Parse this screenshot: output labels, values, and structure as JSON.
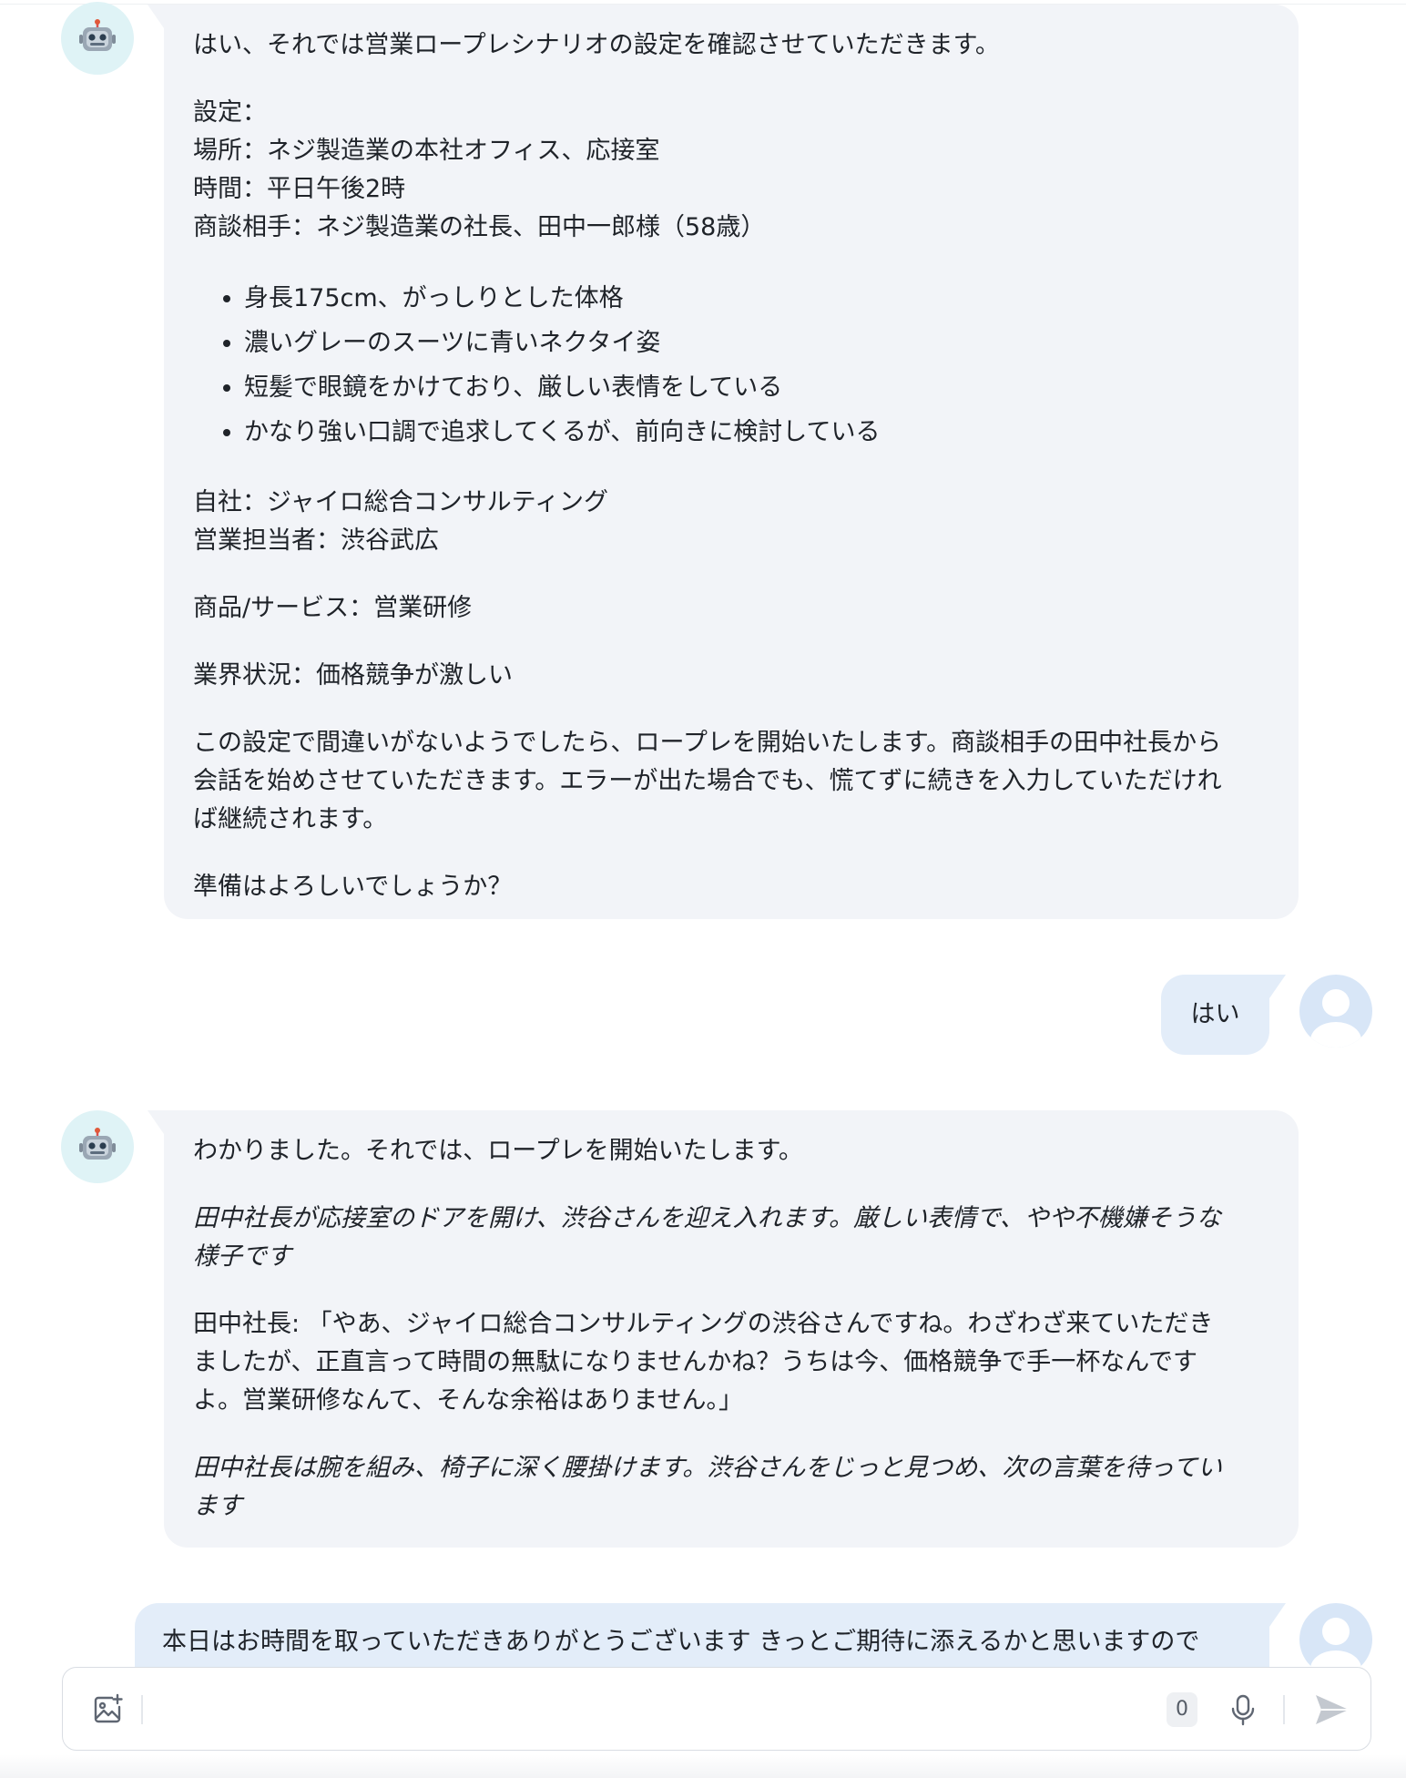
{
  "colors": {
    "bot_bubble": "#f2f4f8",
    "user_bubble": "#e3edf9",
    "bot_avatar_bg": "#dff3f6",
    "user_avatar_bg": "#d8e6f7",
    "text": "#1f2329"
  },
  "icons": {
    "bot_avatar": "robot-icon",
    "user_avatar": "user-silhouette-icon",
    "image_upload": "image-plus-icon",
    "mic": "microphone-icon",
    "send": "send-icon"
  },
  "messages": [
    {
      "role": "assistant",
      "intro": "はい、それでは営業ロープレシナリオの設定を確認させていただきます。",
      "setting_lines": [
        "設定：",
        "場所：ネジ製造業の本社オフィス、応接室",
        "時間：平日午後2時",
        "商談相手：ネジ製造業の社長、田中一郎様（58歳）"
      ],
      "bullets": [
        "身長175cm、がっしりとした体格",
        "濃いグレーのスーツに青いネクタイ姿",
        "短髪で眼鏡をかけており、厳しい表情をしている",
        "かなり強い口調で追求してくるが、前向きに検討している"
      ],
      "company_lines": [
        "自社：ジャイロ総合コンサルティング",
        "営業担当者：渋谷武広"
      ],
      "product": "商品/サービス：営業研修",
      "industry": "業界状況：価格競争が激しい",
      "closing_lines": [
        "この設定で間違いがないようでしたら、ロープレを開始いたします。商談相手の田中社長から",
        "会話を始めさせていただきます。エラーが出た場合でも、慌てずに続きを入力していただけれ",
        "ば継続されます。"
      ],
      "question": "準備はよろしいでしょうか？"
    },
    {
      "role": "user",
      "text": "はい"
    },
    {
      "role": "assistant",
      "intro": "わかりました。それでは、ロープレを開始いたします。",
      "narration1_lines": [
        "田中社長が応接室のドアを開け、渋谷さんを迎え入れます。厳しい表情で、やや不機嫌そうな",
        "様子です"
      ],
      "speech_lines": [
        "田中社長: 「やあ、ジャイロ総合コンサルティングの渋谷さんですね。わざわざ来ていただき",
        "ましたが、正直言って時間の無駄になりませんかね？うちは今、価格競争で手一杯なんです",
        "よ。営業研修なんて、そんな余裕はありません。」"
      ],
      "narration2_lines": [
        "田中社長は腕を組み、椅子に深く腰掛けます。渋谷さんをじっと見つめ、次の言葉を待ってい",
        "ます"
      ]
    },
    {
      "role": "user",
      "text": "本日はお時間を取っていただきありがとうございます きっとご期待に添えるかと思いますので"
    }
  ],
  "composer": {
    "value": "",
    "counter": "0"
  }
}
